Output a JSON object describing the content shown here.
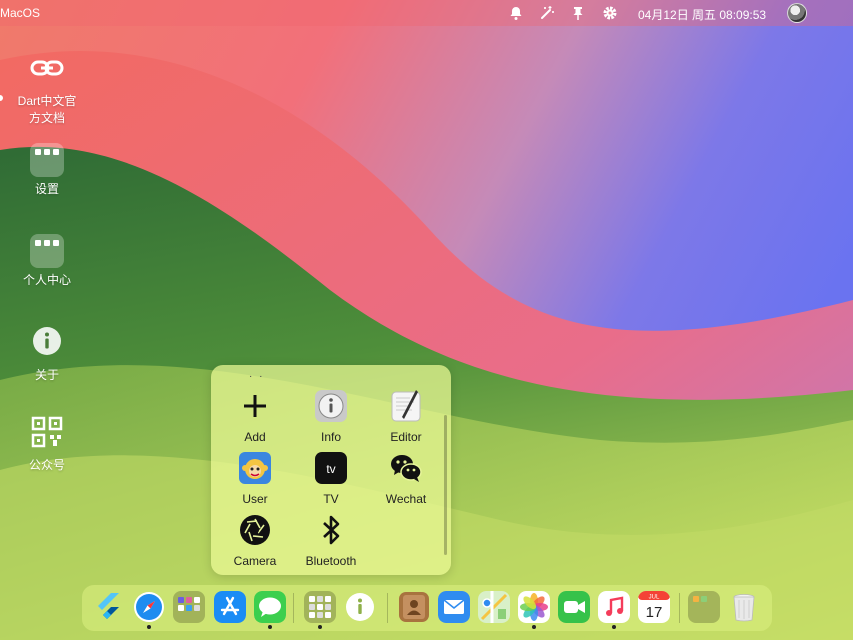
{
  "menubar": {
    "app_name": "MacOS",
    "clock": "04月12日 周五 08:09:53",
    "tray_icons": [
      "bell-icon",
      "magic-wand-icon",
      "pin-icon",
      "gear-icon"
    ]
  },
  "desktop": {
    "items": [
      {
        "label": "Dart中文官方文档",
        "icon": "link-icon"
      },
      {
        "label": "设置",
        "icon": "folder-icon"
      },
      {
        "label": "个人中心",
        "icon": "folder-icon"
      },
      {
        "label": "关于",
        "icon": "info-icon"
      },
      {
        "label": "公众号",
        "icon": "qr-code-icon"
      }
    ]
  },
  "popup": {
    "drag_handle": "· ·",
    "apps": [
      {
        "label": "Add",
        "icon": "plus-icon"
      },
      {
        "label": "Info",
        "icon": "info-icon"
      },
      {
        "label": "Editor",
        "icon": "editor-icon"
      },
      {
        "label": "User",
        "icon": "user-icon"
      },
      {
        "label": "TV",
        "icon": "tv-icon",
        "text": "tv"
      },
      {
        "label": "Wechat",
        "icon": "wechat-icon"
      },
      {
        "label": "Camera",
        "icon": "camera-icon"
      },
      {
        "label": "Bluetooth",
        "icon": "bluetooth-icon"
      }
    ]
  },
  "dock": {
    "items": [
      {
        "icon": "flutter-icon",
        "running": false
      },
      {
        "icon": "safari-icon",
        "running": true
      },
      {
        "icon": "folder-icon",
        "running": false
      },
      {
        "icon": "app-store-icon",
        "running": false
      },
      {
        "icon": "messages-icon",
        "running": true
      },
      {
        "icon": "folder-icon",
        "running": true
      },
      {
        "icon": "info-icon",
        "running": false
      },
      {
        "icon": "contacts-icon",
        "running": false
      },
      {
        "icon": "mail-icon",
        "running": false
      },
      {
        "icon": "maps-icon",
        "running": false
      },
      {
        "icon": "photos-icon",
        "running": true
      },
      {
        "icon": "facetime-icon",
        "running": false
      },
      {
        "icon": "music-icon",
        "running": true
      },
      {
        "icon": "calendar-icon",
        "running": false,
        "month": "JUL",
        "day": "17"
      },
      {
        "icon": "folder-icon",
        "running": false
      },
      {
        "icon": "trash-icon",
        "running": false
      }
    ]
  },
  "colors": {
    "accent_red": "#f0646e",
    "popup_bg": "#ebfa96",
    "dock_bg": "#dcf082"
  }
}
